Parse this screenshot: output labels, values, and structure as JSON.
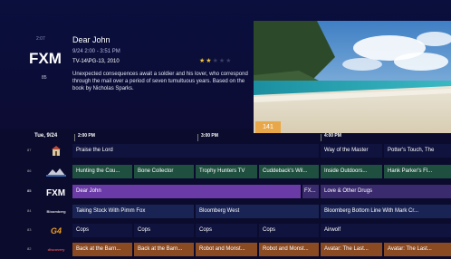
{
  "info": {
    "clock": "2:07",
    "network_logo": "FXM",
    "channel_number": "85",
    "title": "Dear John",
    "airtime": "9/24  2:00 - 3:51 PM",
    "rating_year": "TV-14\\PG-13, 2010",
    "stars_filled": 2,
    "stars_total": 5,
    "description": "Unexpected consequences await a soldier and his lover, who correspond through the mail over a period of seven tumultuous years. Based on the book by Nicholas Sparks.",
    "preview_channel": "141"
  },
  "header": {
    "date": "Tue, 9/24",
    "slots": [
      "2:00 PM",
      "3:00 PM",
      "4:00 PM"
    ]
  },
  "colors": {
    "green": "#1f4f3f",
    "purple": "#6a3aa7",
    "orange": "#8a4a22",
    "star": "#f2c23a",
    "badge": "#e8a84a"
  },
  "rows": [
    {
      "num": "87",
      "logo": "church-icon",
      "programs": [
        "Praise the Lord",
        "Way of the Master",
        "Potter's Touch, The"
      ]
    },
    {
      "num": "86",
      "logo": "outdoor-channel-logo",
      "programs": [
        "Hunting the Cou...",
        "Bone Collector",
        "Trophy Hunters TV",
        "Cuddeback's Wil...",
        "Inside Outdoors...",
        "Hank Parker's Fl..."
      ]
    },
    {
      "num": "85",
      "logo": "FXM",
      "programs": [
        "Dear John",
        "FX...",
        "Love & Other Drugs"
      ]
    },
    {
      "num": "84",
      "logo": "bloomberg-logo",
      "logo_text": "Bloomberg",
      "programs": [
        "Taking Stock With Pimm Fox",
        "Bloomberg West",
        "Bloomberg Bottom Line With Mark Cr..."
      ]
    },
    {
      "num": "83",
      "logo": "G4",
      "programs": [
        "Cops",
        "Cops",
        "Cops",
        "Cops",
        "Airwolf"
      ]
    },
    {
      "num": "82",
      "logo": "discovery-family-logo",
      "logo_text": "discovery",
      "programs": [
        "Back at the Barn...",
        "Back at the Barn...",
        "Robot and Monst...",
        "Robot and Monst...",
        "Avatar: The Last...",
        "Avatar: The Last..."
      ]
    }
  ]
}
